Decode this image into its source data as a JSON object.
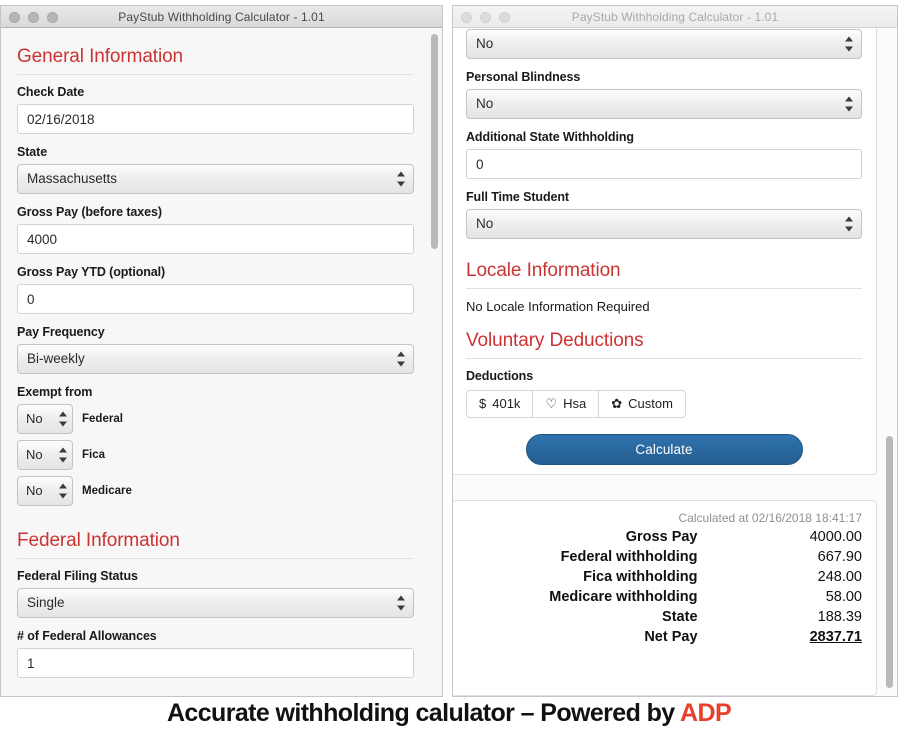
{
  "left_window": {
    "title": "PayStub Withholding Calculator - 1.01",
    "traffic_lights": [
      "close-button",
      "minimize-button",
      "zoom-button"
    ],
    "sections": {
      "general": {
        "heading": "General Information",
        "check_date": {
          "label": "Check Date",
          "value": "02/16/2018"
        },
        "state": {
          "label": "State",
          "value": "Massachusetts"
        },
        "gross_pay": {
          "label": "Gross Pay (before taxes)",
          "value": "4000"
        },
        "gross_pay_ytd": {
          "label": "Gross Pay YTD (optional)",
          "value": "0"
        },
        "pay_frequency": {
          "label": "Pay Frequency",
          "value": "Bi-weekly"
        },
        "exempt_from": {
          "label": "Exempt from",
          "rows": [
            {
              "value": "No",
              "name": "Federal"
            },
            {
              "value": "No",
              "name": "Fica"
            },
            {
              "value": "No",
              "name": "Medicare"
            }
          ]
        }
      },
      "federal": {
        "heading": "Federal Information",
        "filing_status": {
          "label": "Federal Filing Status",
          "value": "Single"
        },
        "allowances": {
          "label": "# of Federal Allowances",
          "value": "1"
        }
      }
    }
  },
  "right_window": {
    "title": "PayStub Withholding Calculator - 1.01",
    "traffic_lights": [
      "close-button",
      "minimize-button",
      "zoom-button"
    ],
    "form": {
      "cutoff_select_value": "No",
      "personal_blindness": {
        "label": "Personal Blindness",
        "value": "No"
      },
      "additional_state_withholding": {
        "label": "Additional State Withholding",
        "value": "0"
      },
      "full_time_student": {
        "label": "Full Time Student",
        "value": "No"
      },
      "locale": {
        "heading": "Locale Information",
        "message": "No Locale Information Required"
      },
      "voluntary": {
        "heading": "Voluntary Deductions",
        "deductions_label": "Deductions",
        "buttons": [
          {
            "icon": "dollar-icon",
            "glyph": "$",
            "label": "401k"
          },
          {
            "icon": "heart-icon",
            "glyph": "♡",
            "label": "Hsa"
          },
          {
            "icon": "gear-icon",
            "glyph": "✿",
            "label": "Custom"
          }
        ]
      },
      "calculate_label": "Calculate"
    },
    "results": {
      "stamp": "Calculated at 02/16/2018 18:41:17",
      "rows": [
        {
          "label": "Gross Pay",
          "value": "4000.00"
        },
        {
          "label": "Federal withholding",
          "value": "667.90"
        },
        {
          "label": "Fica withholding",
          "value": "248.00"
        },
        {
          "label": "Medicare withholding",
          "value": "58.00"
        },
        {
          "label": "State",
          "value": "188.39"
        },
        {
          "label": "Net Pay",
          "value": "2837.71"
        }
      ]
    }
  },
  "caption": {
    "text": "Accurate withholding calulator – Powered by ",
    "brand": "ADP"
  },
  "colors": {
    "heading_red": "#cc3333",
    "brand_red": "#e8402a",
    "button_blue": "#2a6ca8",
    "window_bg": "#f7f7f7"
  }
}
